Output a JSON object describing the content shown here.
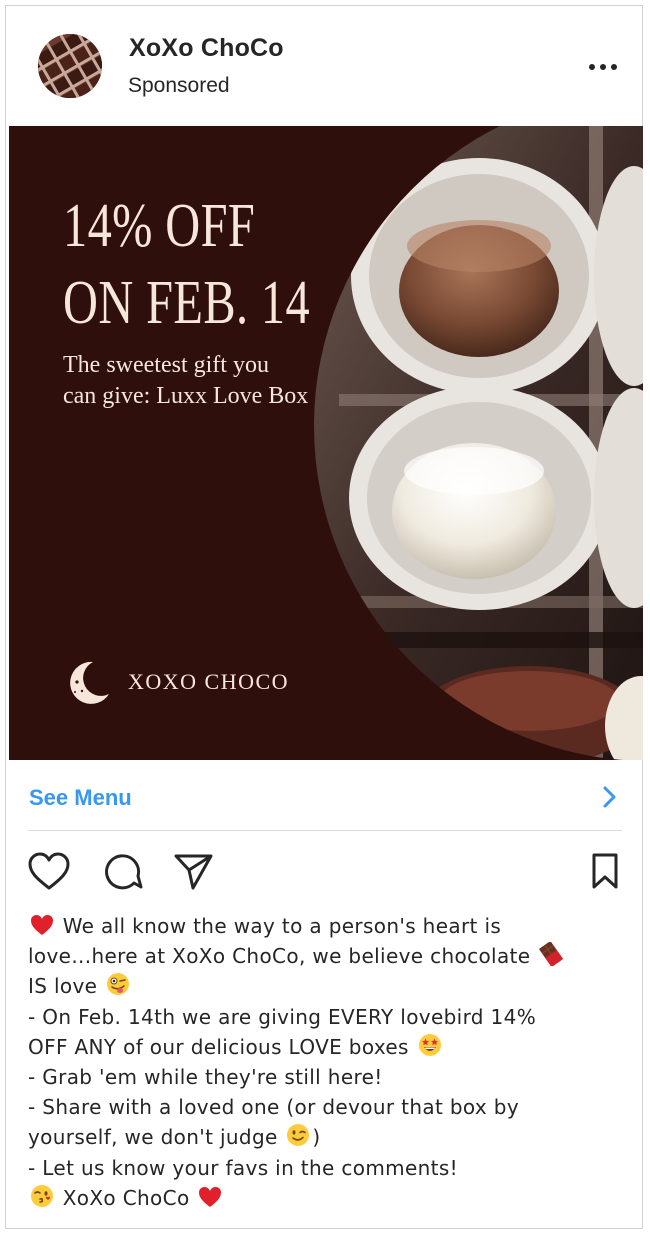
{
  "post": {
    "account_name": "XoXo ChoCo",
    "sponsored_label": "Sponsored",
    "more_icon": "more-horizontal-icon"
  },
  "ad": {
    "headline_line1": "14% OFF",
    "headline_line2": "ON FEB. 14",
    "subhead_line1": "The sweetest gift you",
    "subhead_line2": "can give: Luxx Love Box",
    "logo_text": "XOXO CHOCO",
    "background_color": "#2f0f0b",
    "text_color": "#f7e6da"
  },
  "cta": {
    "label": "See Menu",
    "color": "#3897f0",
    "icon": "chevron-right-icon"
  },
  "actions": {
    "like_icon": "heart-icon",
    "comment_icon": "comment-icon",
    "share_icon": "send-icon",
    "save_icon": "bookmark-icon"
  },
  "caption": {
    "line1": "We all know the way to a person's heart is",
    "line2": "love...here at XoXo ChoCo, we believe chocolate",
    "line3": "IS love",
    "line4": "- On Feb. 14th we are giving EVERY lovebird 14%",
    "line5": "OFF ANY of our delicious LOVE boxes",
    "line6": "- Grab 'em while they're still here!",
    "line7": "- Share with a loved one (or devour that box by",
    "line8": "yourself, we don't judge",
    "line8_end": ")",
    "line9": "- Let us know your favs in the comments!",
    "line10": "XoXo ChoCo"
  }
}
